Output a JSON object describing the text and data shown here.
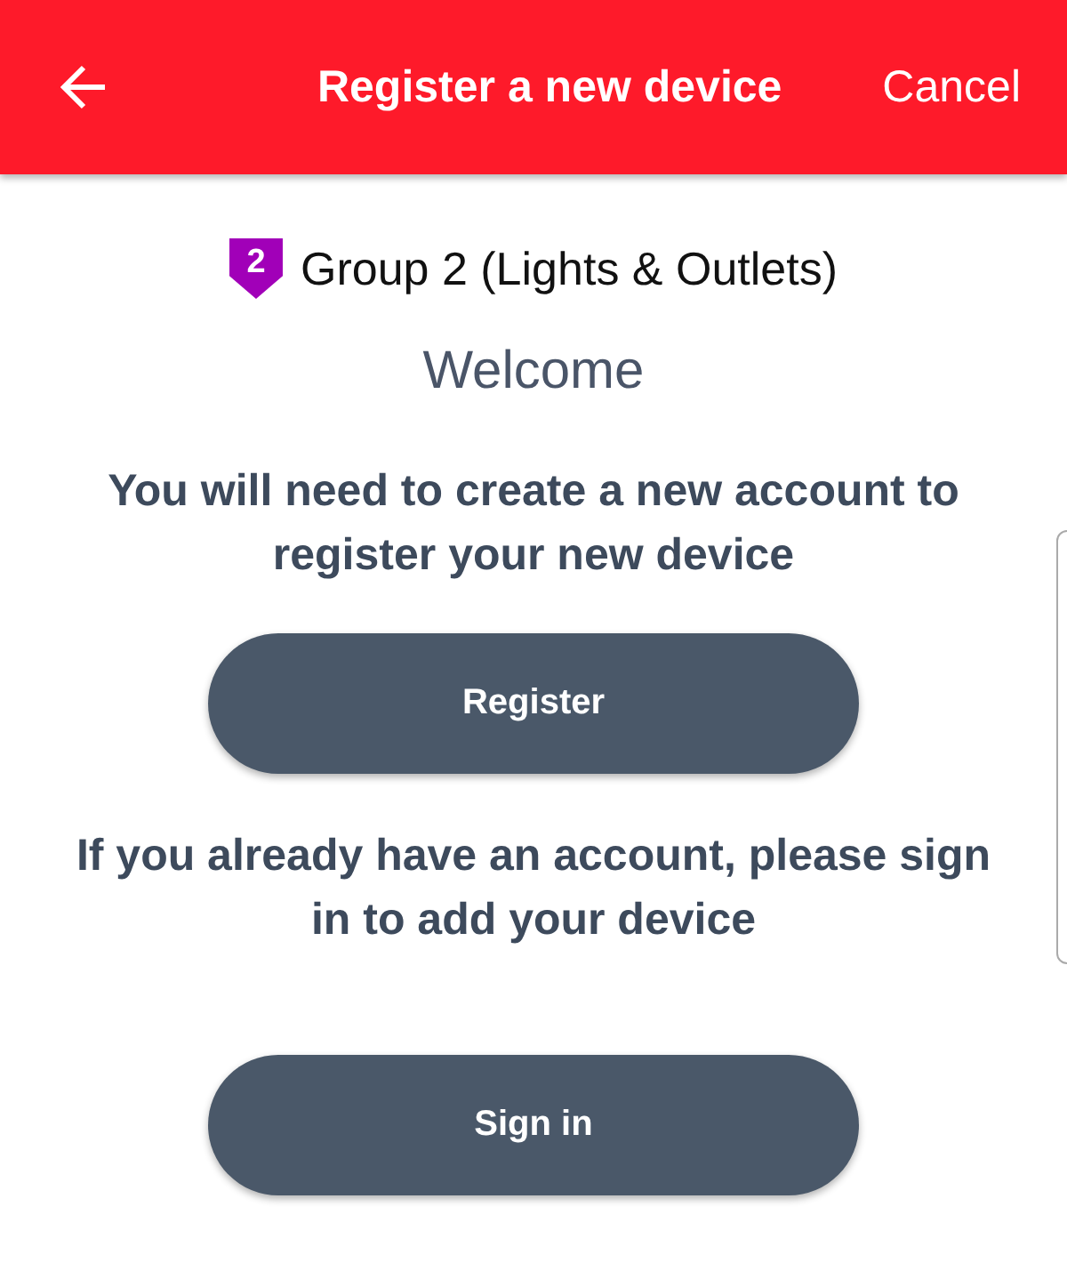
{
  "header": {
    "title": "Register a new device",
    "action": "Cancel"
  },
  "group": {
    "badge": "2",
    "name": "Group 2 (Lights & Outlets)",
    "color": "#a100b8"
  },
  "welcome": "Welcome",
  "sections": [
    {
      "message": "You will need to create a new account to register your new device",
      "button": "Register"
    },
    {
      "message": "If you already have an account, please sign in to add your device",
      "button": "Sign in"
    }
  ]
}
